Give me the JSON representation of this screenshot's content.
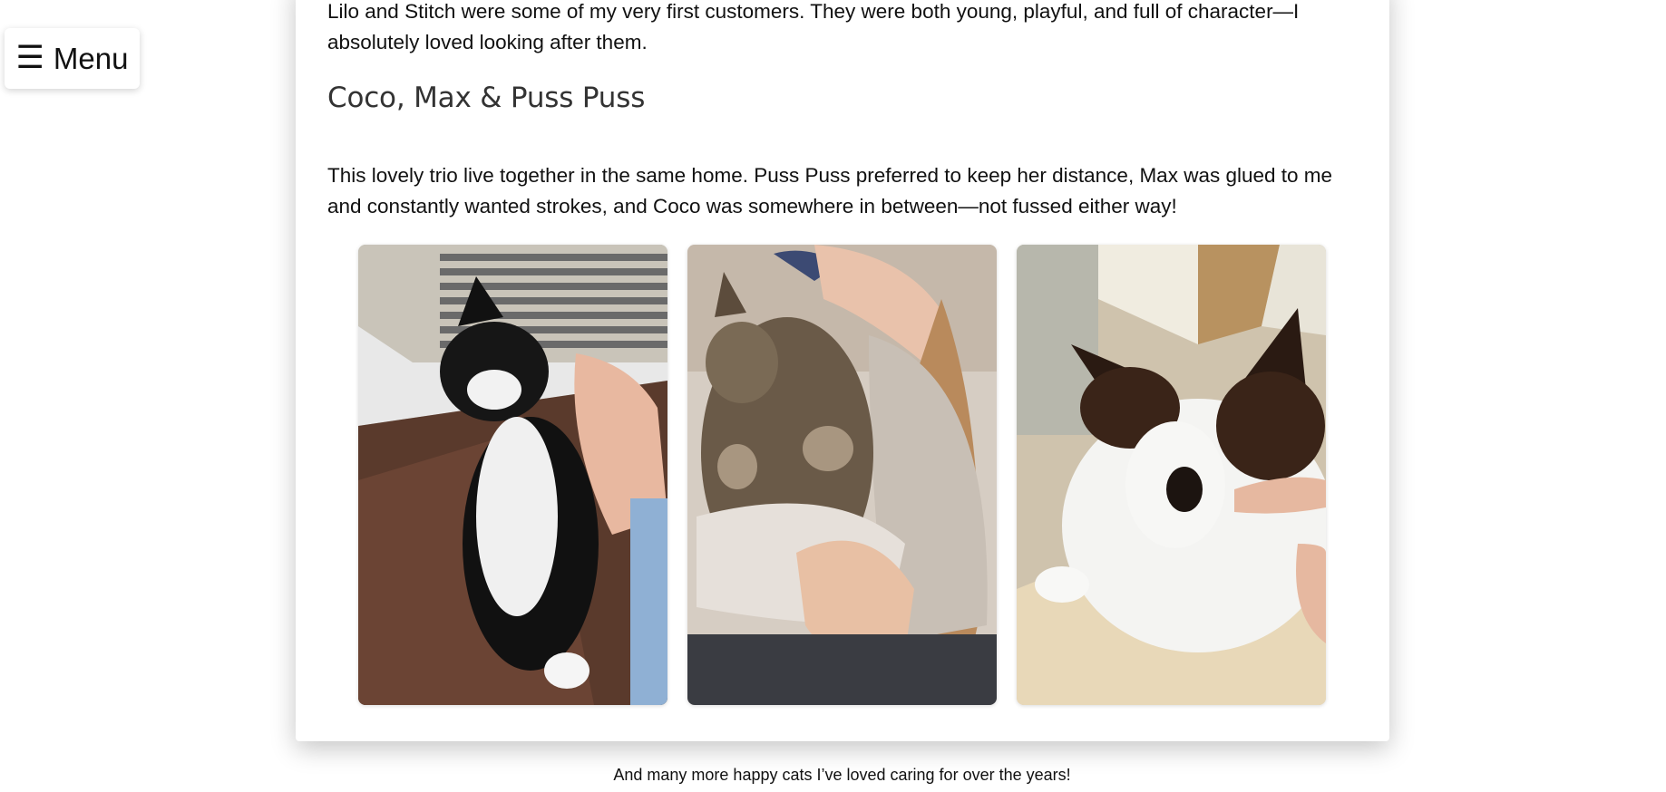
{
  "menu": {
    "icon": "hamburger-icon",
    "icon_glyph": "☰",
    "label": "Menu"
  },
  "content": {
    "intro_paragraph": "Lilo and Stitch were some of my very first customers. They were both young, playful, and full of character—I absolutely loved looking after them.",
    "section_heading": "Coco, Max & Puss Puss",
    "section_paragraph": "This lovely trio live together in the same home. Puss Puss preferred to keep her distance, Max was glued to me and constantly wanted strokes, and Coco was somewhere in between—not fussed either way!",
    "photos": [
      {
        "subject": "black-and-white cat by window being stroked"
      },
      {
        "subject": "tabby cat held in arms"
      },
      {
        "subject": "black-and-white cat sniffing finger"
      }
    ]
  },
  "footer": {
    "text": "And many more happy cats I’ve loved caring for over the years!"
  },
  "colors": {
    "background": "#ffffff",
    "card": "#ffffff",
    "text": "#111111",
    "heading": "#333333"
  }
}
